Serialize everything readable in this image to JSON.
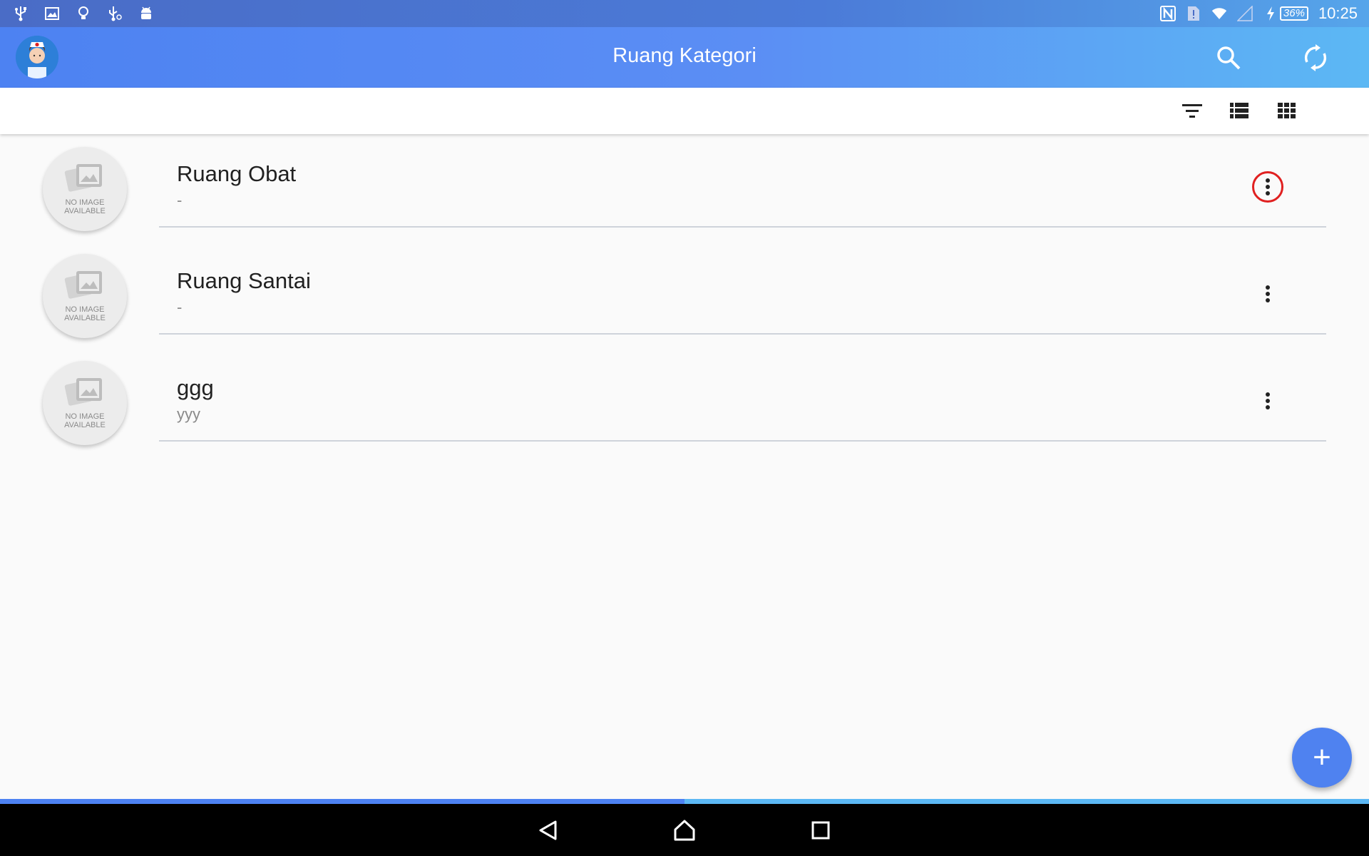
{
  "status_bar": {
    "clock": "10:25",
    "battery": "36%",
    "left_icons": [
      "usb-icon",
      "image-icon",
      "bulb-icon",
      "usb-debug-icon",
      "android-icon"
    ],
    "right_icons": [
      "nfc-icon",
      "sim-alert-icon",
      "wifi-icon",
      "cell-signal-icon",
      "charging-icon"
    ]
  },
  "app_bar": {
    "title": "Ruang Kategori",
    "avatar": "nurse-avatar",
    "actions": [
      "search-icon",
      "sync-icon"
    ]
  },
  "toolbar": {
    "actions": [
      "filter-icon",
      "list-view-icon",
      "grid-view-icon"
    ]
  },
  "items": [
    {
      "title": "Ruang Obat",
      "subtitle": "-",
      "thumb_text": "NO IMAGE AVAILABLE",
      "more_highlighted": true
    },
    {
      "title": "Ruang Santai",
      "subtitle": "-",
      "thumb_text": "NO IMAGE AVAILABLE",
      "more_highlighted": false
    },
    {
      "title": "ggg",
      "subtitle": "yyy",
      "thumb_text": "NO IMAGE AVAILABLE",
      "more_highlighted": false
    }
  ],
  "fab": {
    "label": "+"
  },
  "navigation": [
    "back-icon",
    "home-icon",
    "recents-icon"
  ],
  "colors": {
    "primary": "#4d82f2",
    "accent_light": "#5cb8f4",
    "highlight_ring": "#e02020"
  }
}
